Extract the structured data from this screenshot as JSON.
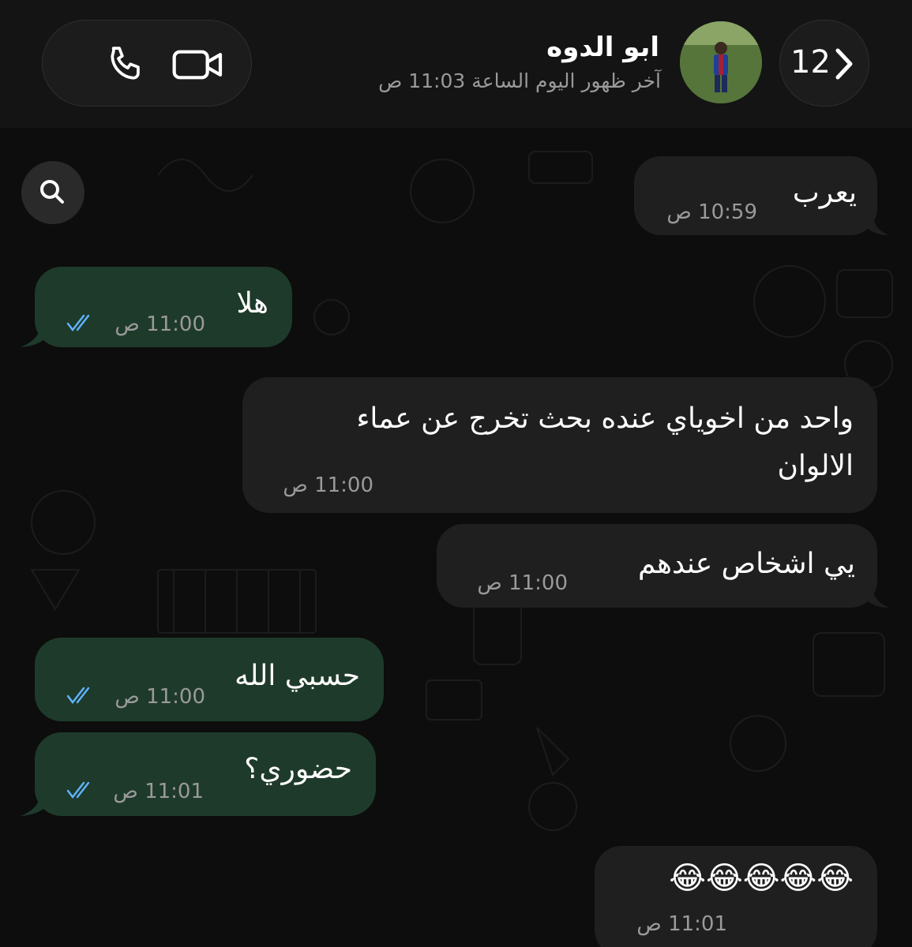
{
  "header": {
    "contact_name": "ابو الدوه",
    "last_seen": "آخر ظهور اليوم الساعة 11:03 ص",
    "back_count": "12",
    "phone_icon": "phone-icon",
    "video_icon": "video-camera-icon",
    "back_icon": "chevron-right-icon"
  },
  "colors": {
    "incoming_bubble": "#1f1f1f",
    "outgoing_bubble": "#1e3a2b",
    "read_ticks": "#5fb4ff",
    "background": "#0d0d0d"
  },
  "messages": [
    {
      "direction": "incoming",
      "text": "يعرب",
      "time": "10:59 ص"
    },
    {
      "direction": "outgoing",
      "text": "هلا",
      "time": "11:00 ص",
      "status": "read"
    },
    {
      "direction": "incoming",
      "text": "واحد من اخوياي عنده بحث تخرج عن عماء",
      "text2": "الالوان",
      "time": "11:00 ص"
    },
    {
      "direction": "incoming",
      "text": "يي اشخاص عندهم",
      "time": "11:00 ص"
    },
    {
      "direction": "outgoing",
      "text": "حسبي الله",
      "time": "11:00 ص",
      "status": "read"
    },
    {
      "direction": "outgoing",
      "text": "حضوري؟",
      "time": "11:01 ص",
      "status": "read"
    },
    {
      "direction": "incoming",
      "text": "😂😂😂😂😂",
      "time": "11:01 ص"
    }
  ]
}
